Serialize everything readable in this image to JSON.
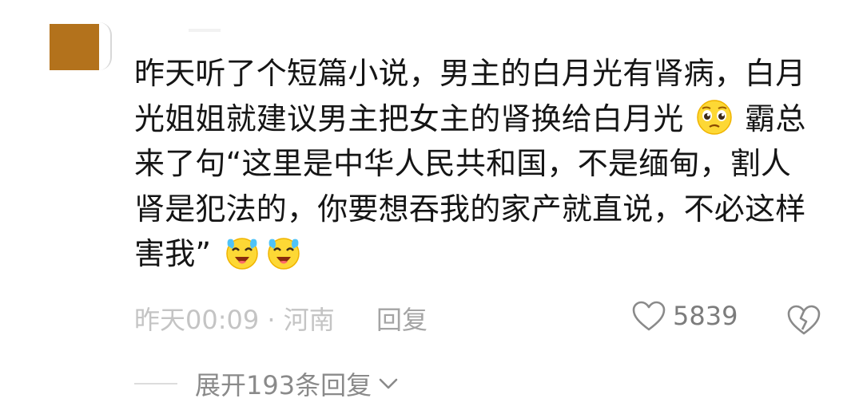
{
  "comment": {
    "line1": "昨天听了个短篇小说，男主的白月光有肾病，白月",
    "line2a": "光姐姐就建议男主把女主的肾换给白月光",
    "line2b": "霸总",
    "line3": "来了句“这里是中华人民共和国，不是缅甸，割人",
    "line4": "肾是犯法的，你要想吞我的家产就直说，不必这样",
    "line5": "害我”",
    "emojis": [
      "pleading-face-icon",
      "crying-laugh-icon",
      "crying-laugh-icon"
    ]
  },
  "meta": {
    "time": "昨天00:09",
    "separator": " · ",
    "location": "河南",
    "reply_label": "回复"
  },
  "likes": {
    "count": "5839"
  },
  "expand": {
    "label": "展开193条回复"
  },
  "colors": {
    "avatar": "#b3721c",
    "text": "#151515",
    "meta": "#c4c4c4"
  }
}
